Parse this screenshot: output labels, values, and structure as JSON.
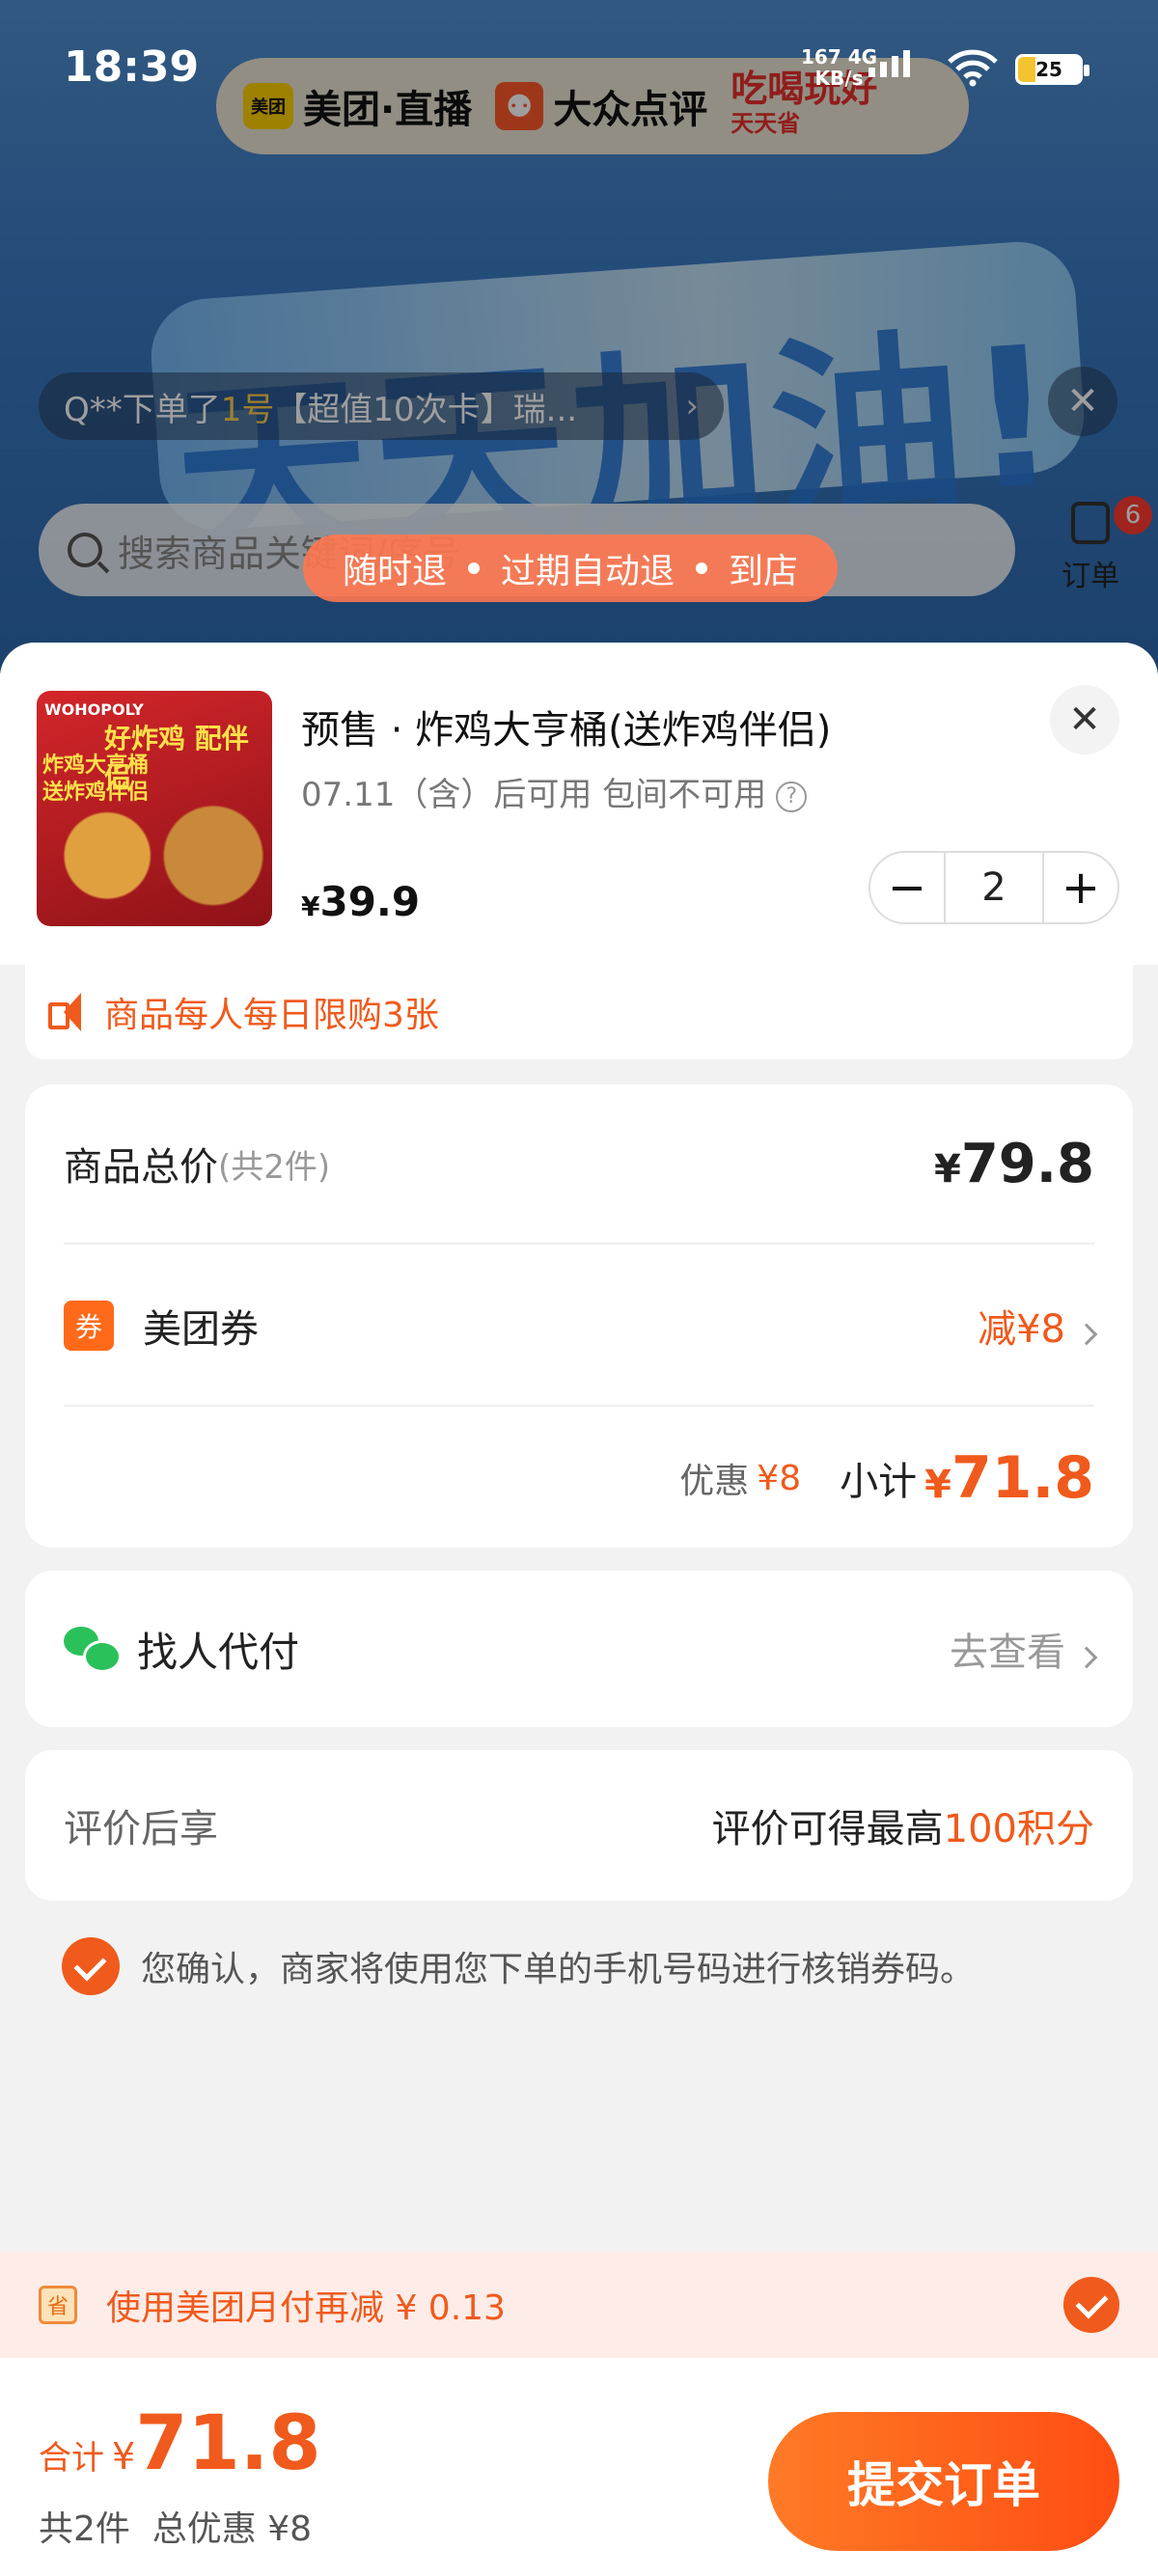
{
  "status_bar": {
    "time": "18:39",
    "net_speed": "167",
    "net_unit": "KB/s",
    "net_type": "4G",
    "battery": "25"
  },
  "background": {
    "brand_meituan": "美团·直播",
    "brand_meituan_logo": "美团",
    "brand_dianping": "大众点评",
    "brand_tag_top": "吃喝玩好",
    "brand_tag_bottom": "天天省",
    "banner_text": "天天加油!",
    "ticker_pre": "Q**下单了",
    "ticker_hl": "1号",
    "ticker_post": "【超值10次卡】瑞...",
    "search_placeholder": "搜索商品关键词/序号",
    "orders_label": "订单",
    "orders_badge": "6",
    "refund_tags": [
      "随时退",
      "过期自动退",
      "到店"
    ]
  },
  "product": {
    "title": "预售 · 炸鸡大亨桶(送炸鸡伴侣)",
    "usage": "07.11（含）后可用 包间不可用",
    "price_symbol": "¥",
    "price": "39.9",
    "quantity": "2",
    "image_brand": "WOHOPOLY",
    "image_line1": "好炸鸡 配伴侣",
    "image_line2": "炸鸡大亨桶\n送炸鸡伴侣"
  },
  "limit_notice": "商品每人每日限购3张",
  "summary": {
    "total_label": "商品总价",
    "total_count": "(共2件)",
    "total_symbol": "¥",
    "total_value": "79.8",
    "coupon_icon": "券",
    "coupon_label": "美团券",
    "coupon_discount": "减¥8",
    "discount_label": "优惠",
    "discount_value": "¥8",
    "subtotal_label": "小计",
    "subtotal_symbol": "¥",
    "subtotal_value": "71.8"
  },
  "proxy_pay": {
    "label": "找人代付",
    "action": "去查看"
  },
  "review": {
    "label": "评价后享",
    "text": "评价可得最高",
    "points": "100积分"
  },
  "confirm_text": "您确认，商家将使用您下单的手机号码进行核销券码。",
  "monthly_pay": {
    "icon": "省",
    "text": "使用美团月付再减 ¥ 0.13"
  },
  "footer": {
    "total_label": "合计",
    "total_symbol": "¥",
    "total_value": "71.8",
    "sub": "共2件  总优惠 ¥8",
    "submit": "提交订单"
  },
  "colors": {
    "accent": "#f05a1c",
    "wechat": "#2bc15a",
    "submit_start": "#ff7a26",
    "submit_end": "#ff4d12"
  }
}
